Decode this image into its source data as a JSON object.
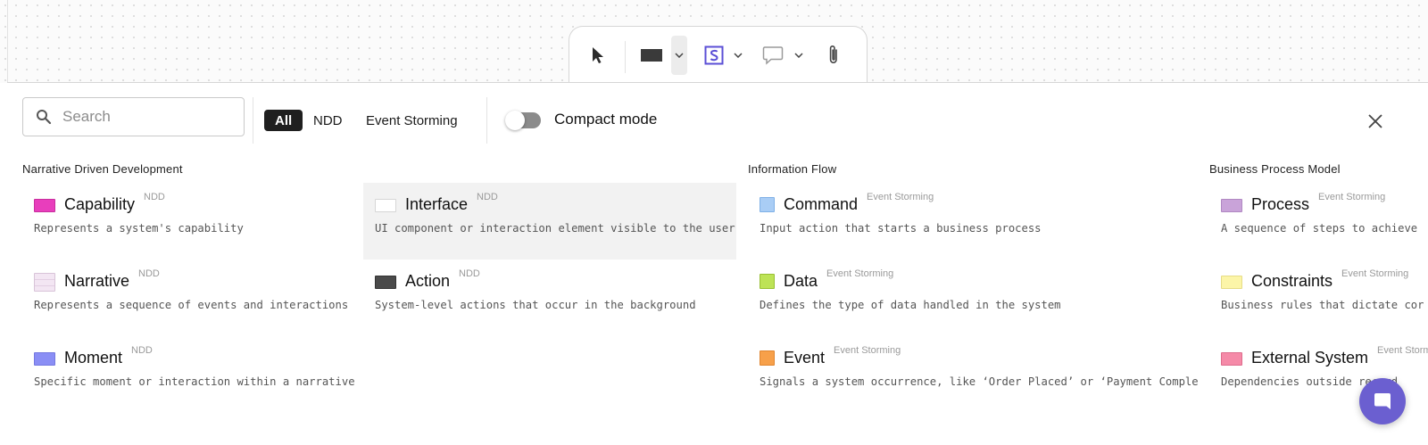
{
  "toolbar": {
    "tools": [
      {
        "name": "pointer-tool",
        "icon": "cursor-arrow-icon"
      },
      {
        "name": "shape-tool",
        "icon": "rectangle-icon"
      },
      {
        "name": "sticky-tool",
        "icon": "s-badge-icon"
      },
      {
        "name": "comment-tool",
        "icon": "speech-bubble-icon"
      },
      {
        "name": "attach-tool",
        "icon": "paperclip-icon"
      }
    ]
  },
  "panel": {
    "search": {
      "placeholder": "Search",
      "value": ""
    },
    "filters": [
      "All",
      "NDD",
      "Event Storming"
    ],
    "active_filter": "All",
    "compact_mode": {
      "label": "Compact mode",
      "enabled": false
    },
    "sections": [
      {
        "title": "Narrative Driven Development",
        "items": [
          {
            "name": "Capability",
            "tag": "NDD",
            "desc": "Represents a system's capability",
            "color": "#e83ebc"
          },
          {
            "name": "Interface",
            "tag": "NDD",
            "desc": "UI component or interaction element visible to the user",
            "color": "#ffffff"
          },
          {
            "name": "Narrative",
            "tag": "NDD",
            "desc": "Represents a sequence of events and interactions",
            "color": "#f3e6f3"
          },
          {
            "name": "Action",
            "tag": "NDD",
            "desc": "System-level actions that occur in the background",
            "color": "#4a4a4a"
          },
          {
            "name": "Moment",
            "tag": "NDD",
            "desc": "Specific moment or interaction within a narrative",
            "color": "#8a8ef5"
          }
        ]
      },
      {
        "title": "Information Flow",
        "items": [
          {
            "name": "Command",
            "tag": "Event Storming",
            "desc": "Input action that starts a business process",
            "color": "#a9cdf5"
          },
          {
            "name": "Data",
            "tag": "Event Storming",
            "desc": "Defines the type of data handled in the system",
            "color": "#bde356"
          },
          {
            "name": "Event",
            "tag": "Event Storming",
            "desc": "Signals a system occurrence, like ‘Order Placed’ or ‘Payment Completed.’",
            "color": "#f7a04a"
          }
        ]
      },
      {
        "title": "Business Process Model",
        "items": [
          {
            "name": "Process",
            "tag": "Event Storming",
            "desc": "A sequence of steps to achieve",
            "color": "#c9a3d9"
          },
          {
            "name": "Constraints",
            "tag": "Event Storming",
            "desc": "Business rules that dictate cor",
            "color": "#fcf5a8"
          },
          {
            "name": "External System",
            "tag": "Event Storming",
            "desc": "Dependencies outside record",
            "color": "#f58aa8"
          }
        ]
      }
    ]
  }
}
